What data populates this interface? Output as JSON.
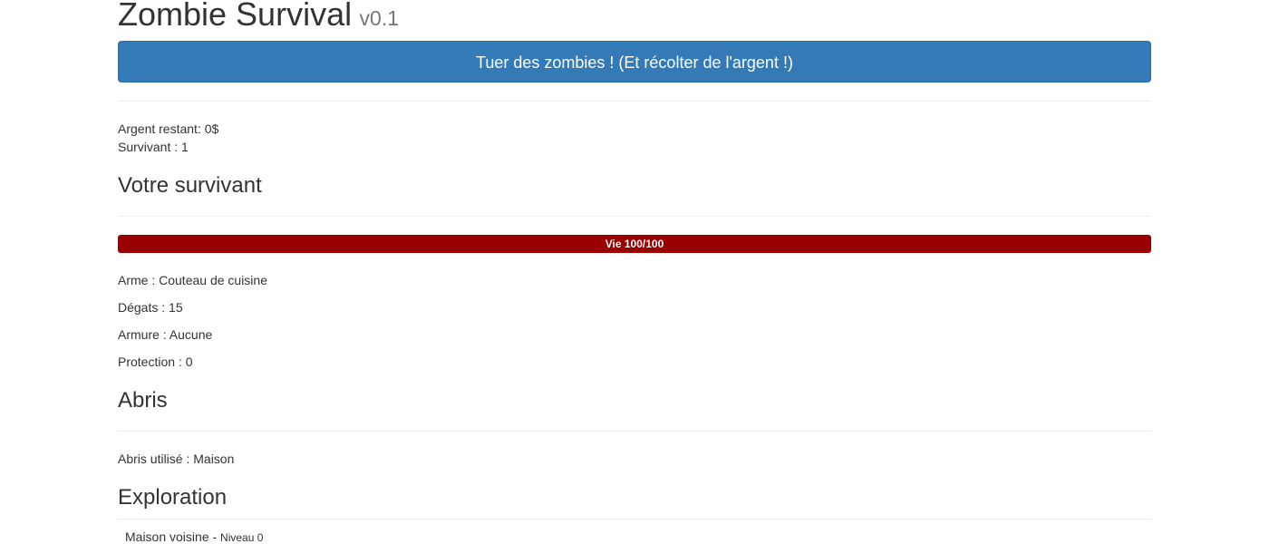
{
  "header": {
    "title": "Zombie Survival",
    "version": "v0.1"
  },
  "actions": {
    "kill_button_label": "Tuer des zombies ! (Et récolter de l'argent !)"
  },
  "stats": {
    "money_label": "Argent restant: ",
    "money_value": "0$",
    "survivors_label": "Survivant : ",
    "survivors_value": "1"
  },
  "survivor": {
    "heading": "Votre survivant",
    "health_label": "Vie 100/100",
    "health_fraction": 1.0,
    "health_color": "#990000",
    "weapon_label": "Arme : ",
    "weapon_value": "Couteau de cuisine",
    "damage_label": "Dégats : ",
    "damage_value": "15",
    "armor_label": "Armure : ",
    "armor_value": "Aucune",
    "protection_label": "Protection : ",
    "protection_value": "0"
  },
  "shelter": {
    "heading": "Abris",
    "used_label": "Abris utilisé : ",
    "used_value": "Maison"
  },
  "exploration": {
    "heading": "Exploration",
    "items": [
      {
        "name": "Maison voisine - ",
        "level": "Niveau 0"
      }
    ]
  },
  "colors": {
    "primary_button": "#337ab7",
    "health_bar": "#990000"
  }
}
